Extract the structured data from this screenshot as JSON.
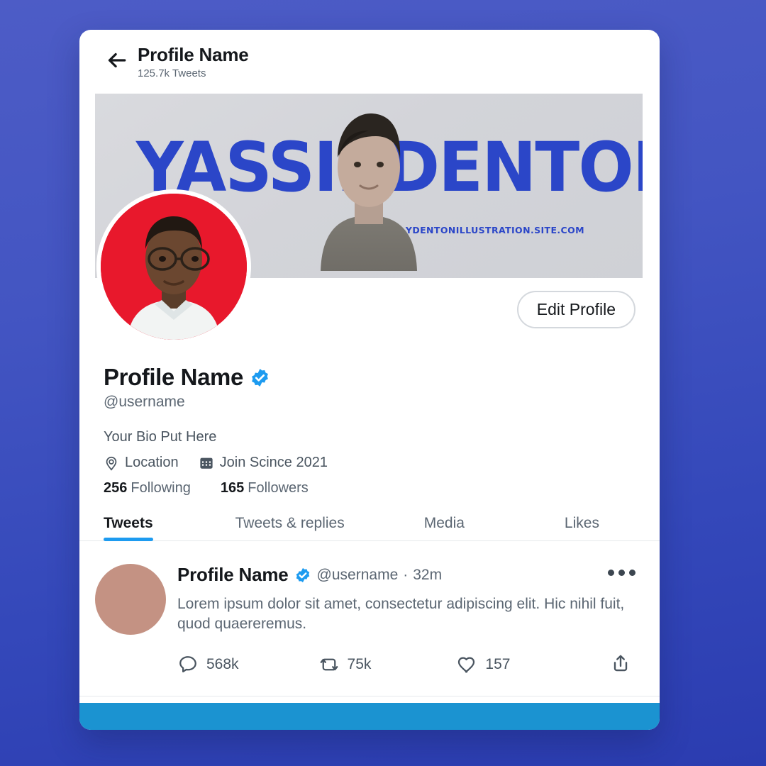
{
  "theme": {
    "background_gradient_start": "#4d5cc6",
    "background_gradient_end": "#2b3cb0",
    "card_background": "#ffffff",
    "accent_blue": "#1d9bf0",
    "bottom_bar": "#1b93d1",
    "avatar_ring_red": "#e8182c",
    "banner_blue": "#2b46c8",
    "tweet_avatar": "#c49283"
  },
  "header": {
    "back_icon": "arrow-left-icon",
    "title": "Profile Name",
    "tweet_count": "125.7k Tweets"
  },
  "banner": {
    "word_1": "YASSIR",
    "word_2": "DENTON",
    "url": "YDENTONILLUSTRATION.SITE.COM"
  },
  "profile": {
    "edit_button": "Edit Profile",
    "display_name": "Profile Name",
    "verified": true,
    "handle": "@username",
    "bio": "Your Bio Put Here",
    "location_icon": "location-pin-icon",
    "location": "Location",
    "join_icon": "calendar-icon",
    "join_date": "Join Scince 2021",
    "following_count": "256",
    "following_label": "Following",
    "followers_count": "165",
    "followers_label": "Followers"
  },
  "tabs": [
    {
      "label": "Tweets",
      "active": true
    },
    {
      "label": "Tweets & replies",
      "active": false
    },
    {
      "label": "Media",
      "active": false
    },
    {
      "label": "Likes",
      "active": false
    }
  ],
  "tweet": {
    "author": "Profile Name",
    "verified": true,
    "handle": "@username",
    "separator": "·",
    "time": "32m",
    "more_icon": "more-horizontal-icon",
    "text": "Lorem ipsum dolor sit amet, consectetur adipiscing elit. Hic nihil fuit, quod quaereremus.",
    "actions": {
      "reply_icon": "comment-icon",
      "reply_count": "568k",
      "retweet_icon": "retweet-icon",
      "retweet_count": "75k",
      "like_icon": "heart-icon",
      "like_count": "157",
      "share_icon": "share-icon"
    }
  }
}
